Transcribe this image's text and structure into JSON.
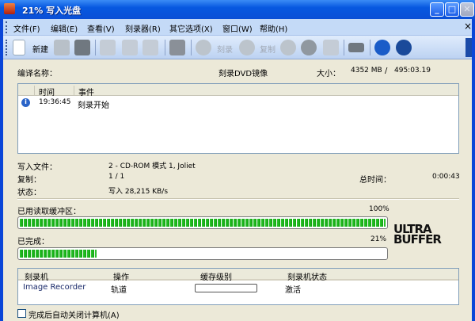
{
  "window": {
    "title": "21% 写入光盘",
    "minimize": "_",
    "maximize": "□",
    "close": "✕"
  },
  "menu": [
    "文件(F)",
    "编辑(E)",
    "查看(V)",
    "刻录器(R)",
    "其它选项(X)",
    "窗口(W)",
    "帮助(H)"
  ],
  "menu_close": "×",
  "toolbar": {
    "new_label": "新建",
    "burn_label": "刻录",
    "copy_label": "复制"
  },
  "info": {
    "name_label": "编译名称：",
    "name_value": "刻录DVD镜像",
    "size_label": "大小：",
    "size_value": "4352 MB",
    "separator": "/",
    "time_value": "495:03.19"
  },
  "log": {
    "columns": [
      "时间",
      "事件"
    ],
    "rows": [
      {
        "time": "19:36:45",
        "event": "刻录开始"
      }
    ]
  },
  "status": {
    "file_label": "写入文件：",
    "file_value": "2 - CD-ROM 模式 1, Joliet",
    "copy_label": "复制：",
    "copy_value": "1 / 1",
    "total_time_label": "总时间：",
    "total_time_value": "0:00:43",
    "state_label": "状态：",
    "state_value": "写入 28,215 KB/s"
  },
  "buffer": {
    "label": "已用读取缓冲区：",
    "percent_text": "100%",
    "value": 100
  },
  "progress": {
    "label": "已完成：",
    "percent_text": "21%",
    "value": 21
  },
  "logo": {
    "line1": "ULTRA",
    "line2": "BUFFER"
  },
  "recorders": {
    "columns": [
      "刻录机",
      "操作",
      "缓存级别",
      "刻录机状态"
    ],
    "rows": [
      {
        "name": "Image Recorder",
        "operation": "轨道",
        "cache": 0,
        "state": "激活"
      }
    ]
  },
  "shutdown": {
    "label": "完成后自动关闭计算机(A)",
    "checked": false
  },
  "colors": {
    "progress_green": "#10a010",
    "titlebar": "#0a4fd6",
    "body": "#ece9d8"
  }
}
